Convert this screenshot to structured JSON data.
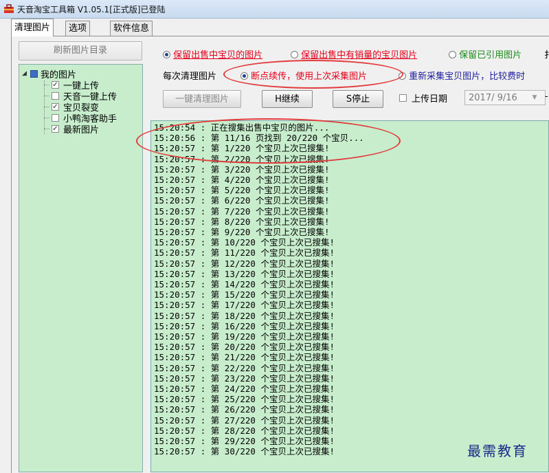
{
  "window": {
    "title": "天音淘宝工具箱 V1.05.1[正式版]已登陆"
  },
  "tabs": [
    {
      "label": "清理图片",
      "active": true
    },
    {
      "label": "选项",
      "active": false
    },
    {
      "label": "软件信息",
      "active": false
    }
  ],
  "left": {
    "refresh_label": "刷新图片目录",
    "tree": {
      "root_label": "我的图片",
      "items": [
        {
          "label": "一键上传",
          "checked": true
        },
        {
          "label": "天音一键上传",
          "checked": false
        },
        {
          "label": "宝贝裂变",
          "checked": true
        },
        {
          "label": "小鸭淘客助手",
          "checked": false
        },
        {
          "label": "最新图片",
          "checked": true
        }
      ]
    }
  },
  "options": {
    "keep_selling": "保留出售中宝贝的图片",
    "keep_with_sales": "保留出售中有销量的宝贝图片",
    "keep_referenced": "保留已引用图片",
    "cut_marker": "扌"
  },
  "each_clean": {
    "label": "每次清理图片",
    "resume": "断点续传，使用上次采集图片",
    "recollect": "重新采集宝贝图片，比较费时"
  },
  "buttons": {
    "one_click": "一键清理图片",
    "continue": "H继续",
    "stop": "S停止"
  },
  "upload_date": {
    "label": "上传日期",
    "value": "2017/ 9/16",
    "dropdown_icon": "chevron-down",
    "dash": "-"
  },
  "log": [
    "15:20:54 : 正在搜集出售中宝贝的图片...",
    "15:20:56 : 第 11/16 页找到 20/220 个宝贝...",
    "15:20:57 : 第 1/220 个宝贝上次已搜集!",
    "15:20:57 : 第 2/220 个宝贝上次已搜集!",
    "15:20:57 : 第 3/220 个宝贝上次已搜集!",
    "15:20:57 : 第 4/220 个宝贝上次已搜集!",
    "15:20:57 : 第 5/220 个宝贝上次已搜集!",
    "15:20:57 : 第 6/220 个宝贝上次已搜集!",
    "15:20:57 : 第 7/220 个宝贝上次已搜集!",
    "15:20:57 : 第 8/220 个宝贝上次已搜集!",
    "15:20:57 : 第 9/220 个宝贝上次已搜集!",
    "15:20:57 : 第 10/220 个宝贝上次已搜集!",
    "15:20:57 : 第 11/220 个宝贝上次已搜集!",
    "15:20:57 : 第 12/220 个宝贝上次已搜集!",
    "15:20:57 : 第 13/220 个宝贝上次已搜集!",
    "15:20:57 : 第 14/220 个宝贝上次已搜集!",
    "15:20:57 : 第 15/220 个宝贝上次已搜集!",
    "15:20:57 : 第 17/220 个宝贝上次已搜集!",
    "15:20:57 : 第 18/220 个宝贝上次已搜集!",
    "15:20:57 : 第 16/220 个宝贝上次已搜集!",
    "15:20:57 : 第 19/220 个宝贝上次已搜集!",
    "15:20:57 : 第 20/220 个宝贝上次已搜集!",
    "15:20:57 : 第 21/220 个宝贝上次已搜集!",
    "15:20:57 : 第 22/220 个宝贝上次已搜集!",
    "15:20:57 : 第 23/220 个宝贝上次已搜集!",
    "15:20:57 : 第 24/220 个宝贝上次已搜集!",
    "15:20:57 : 第 25/220 个宝贝上次已搜集!",
    "15:20:57 : 第 26/220 个宝贝上次已搜集!",
    "15:20:57 : 第 27/220 个宝贝上次已搜集!",
    "15:20:57 : 第 28/220 个宝贝上次已搜集!",
    "15:20:57 : 第 29/220 个宝贝上次已搜集!",
    "15:20:57 : 第 30/220 个宝贝上次已搜集!"
  ],
  "watermark": "最需教育",
  "colors": {
    "log_bg": "#c7edcc",
    "highlight": "#e4001b",
    "annotation": "#e23b3b"
  }
}
